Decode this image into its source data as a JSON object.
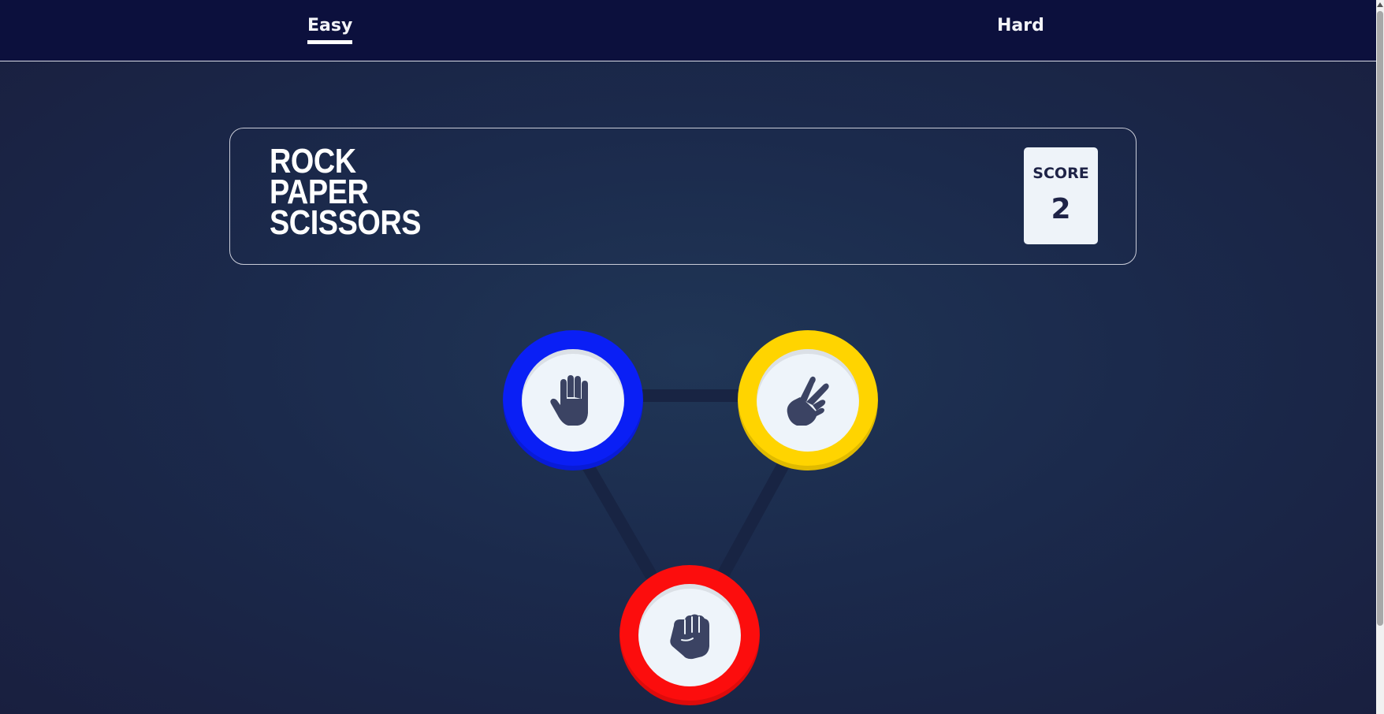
{
  "nav": {
    "tabs": [
      {
        "label": "Easy",
        "active": true
      },
      {
        "label": "Hard",
        "active": false
      }
    ]
  },
  "header": {
    "title_lines": [
      "ROCK",
      "PAPER",
      "SCISSORS"
    ],
    "score_label": "SCORE",
    "score_value": "2"
  },
  "choices": [
    {
      "name": "paper",
      "icon": "paper-hand-icon",
      "color": "#0a1ff5"
    },
    {
      "name": "scissors",
      "icon": "scissors-hand-icon",
      "color": "#ffd400"
    },
    {
      "name": "rock",
      "icon": "rock-fist-icon",
      "color": "#fc0d0d"
    }
  ],
  "colors": {
    "nav_bg": "#0c103d",
    "page_bg": "#1b2a4c",
    "score_text": "#1e2347",
    "icon": "#3b4363"
  }
}
